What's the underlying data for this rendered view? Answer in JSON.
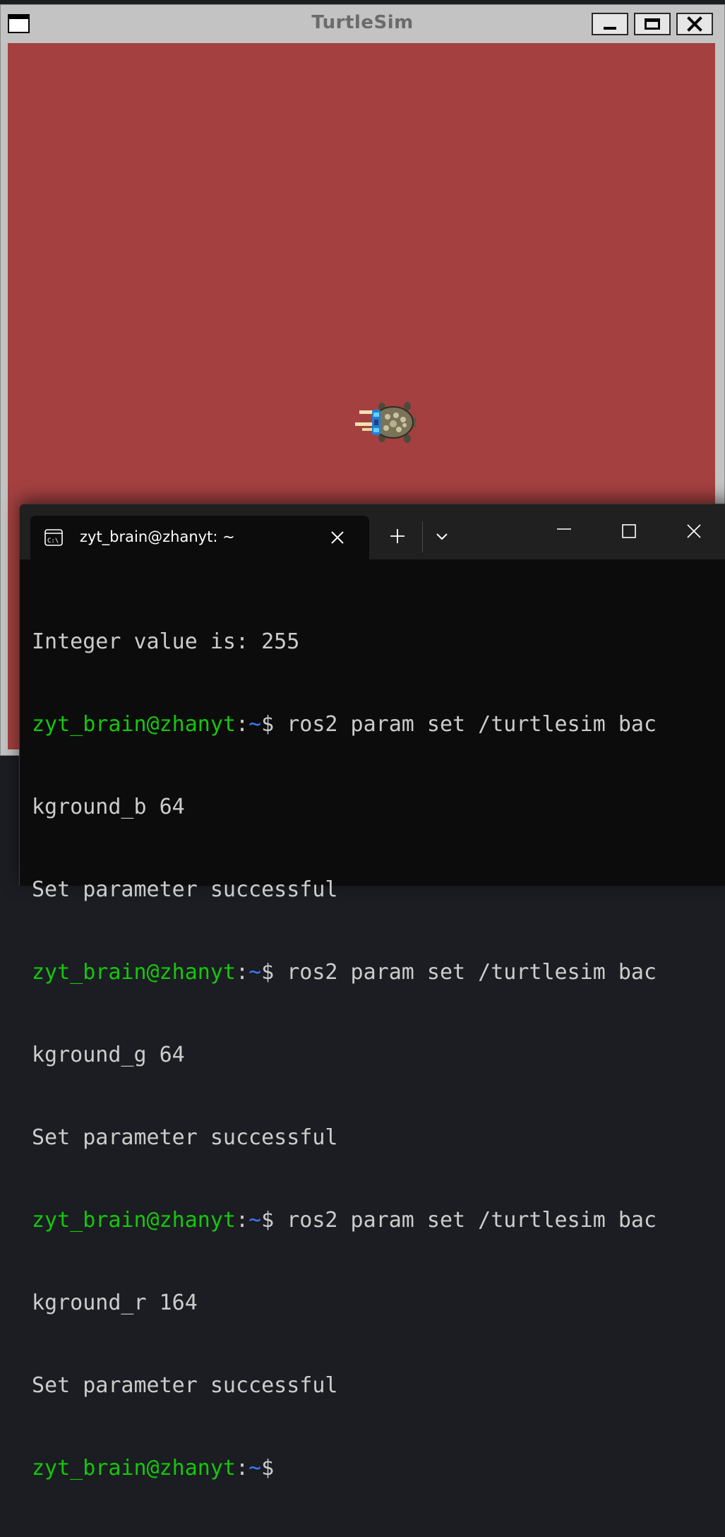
{
  "turtlesim": {
    "title": "TurtleSim",
    "background_color": "#a44040",
    "icons": [
      "window-menu-icon",
      "minimize-icon",
      "maximize-icon",
      "close-icon",
      "turtle-icon"
    ]
  },
  "terminal": {
    "tab_title": "zyt_brain@zhanyt: ~",
    "tab_icon": "terminal-icon",
    "prompt_user": "zyt_brain@zhanyt",
    "prompt_sep": ":",
    "prompt_dir": "~",
    "lines": [
      {
        "type": "output",
        "text": "Integer value is: 255"
      },
      {
        "type": "prompt",
        "cmd": " ros2 param set /turtlesim bac"
      },
      {
        "type": "output",
        "text": "kground_b 64"
      },
      {
        "type": "output",
        "text": "Set parameter successful"
      },
      {
        "type": "prompt",
        "cmd": " ros2 param set /turtlesim bac"
      },
      {
        "type": "output",
        "text": "kground_g 64"
      },
      {
        "type": "output",
        "text": "Set parameter successful"
      },
      {
        "type": "prompt",
        "cmd": " ros2 param set /turtlesim bac"
      },
      {
        "type": "output",
        "text": "kground_r 164"
      },
      {
        "type": "output",
        "text": "Set parameter successful"
      },
      {
        "type": "prompt",
        "cmd": ""
      }
    ],
    "colors": {
      "user": "#16c60c",
      "dir": "#3b78ff",
      "text": "#cccccc",
      "bg": "#0c0c0c"
    }
  }
}
